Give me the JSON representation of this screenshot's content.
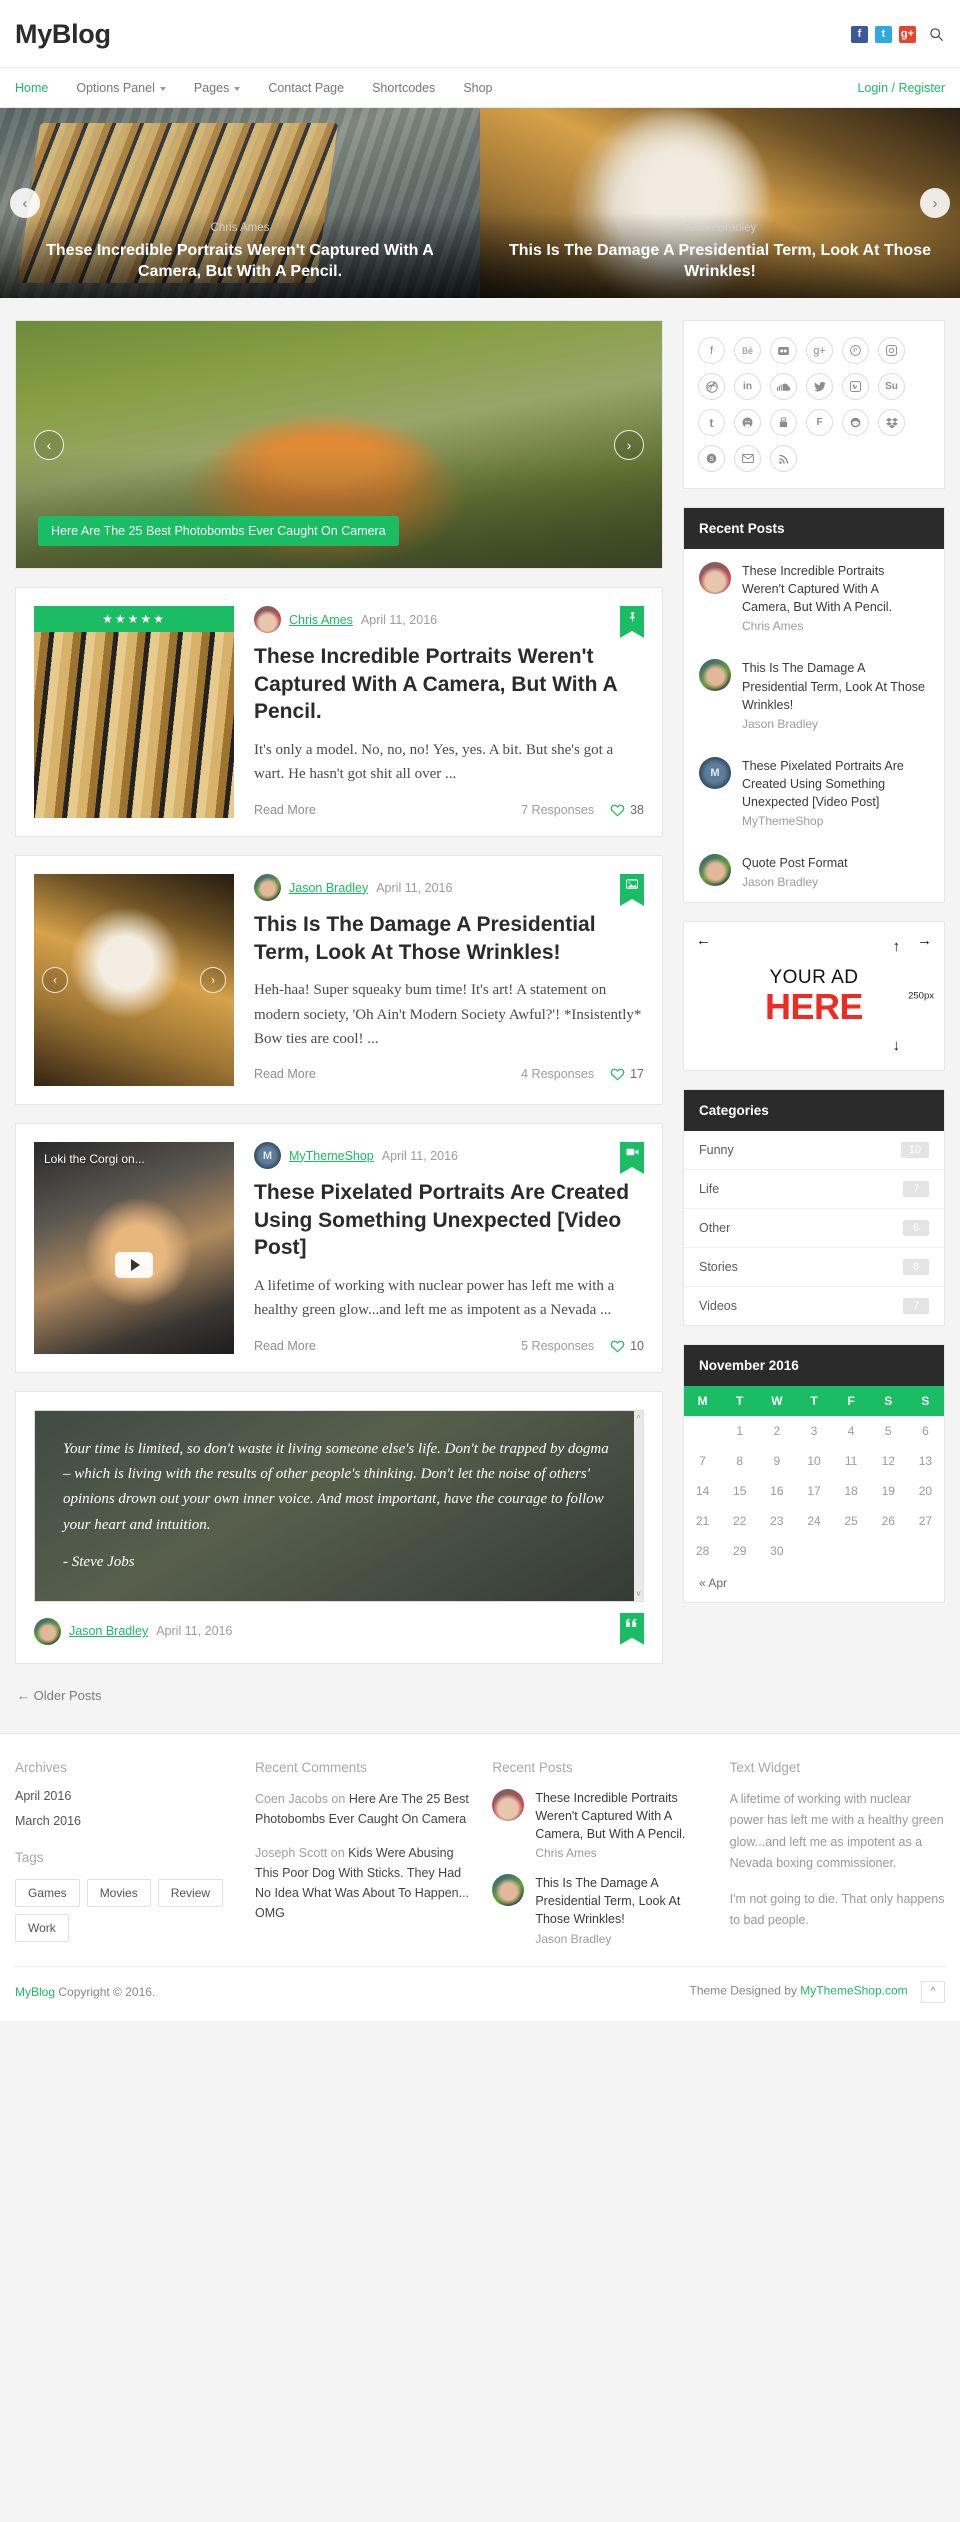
{
  "site": {
    "logo": "MyBlog",
    "social_header": [
      {
        "name": "facebook-icon",
        "glyph": "f"
      },
      {
        "name": "twitter-icon",
        "glyph": "t"
      },
      {
        "name": "googleplus-icon",
        "glyph": "g"
      }
    ],
    "search_icon": "search-icon"
  },
  "nav": {
    "items": [
      {
        "label": "Home",
        "active": true,
        "caret": false
      },
      {
        "label": "Options Panel",
        "active": false,
        "caret": true
      },
      {
        "label": "Pages",
        "active": false,
        "caret": true
      },
      {
        "label": "Contact Page",
        "active": false,
        "caret": false
      },
      {
        "label": "Shortcodes",
        "active": false,
        "caret": false
      },
      {
        "label": "Shop",
        "active": false,
        "caret": false
      }
    ],
    "login": "Login / Register"
  },
  "top_slider": {
    "prev": "‹",
    "next": "›",
    "slides": [
      {
        "author": "Chris Ames",
        "title": "These Incredible Portraits Weren't Captured With A Camera, But With A Pencil."
      },
      {
        "author": "Jason Bradley",
        "title": "This Is The Damage A Presidential Term, Look At Those Wrinkles!"
      }
    ]
  },
  "featured": {
    "caption": "Here Are The 25 Best Photobombs Ever Caught On Camera",
    "prev": "‹",
    "next": "›"
  },
  "posts": [
    {
      "author": "Chris Ames",
      "date": "April 11, 2016",
      "title": "These Incredible Portraits Weren't Captured With A Camera, But With A Pencil.",
      "excerpt": "It's only a model. No, no, no! Yes, yes. A bit. But she's got a wart. He hasn't got shit all over ...",
      "read_more": "Read More",
      "responses": "7 Responses",
      "likes": "38",
      "format_icon": "pin-icon",
      "stars": "★★★★★"
    },
    {
      "author": "Jason Bradley",
      "date": "April 11, 2016",
      "title": "This Is The Damage A Presidential Term, Look At Those Wrinkles!",
      "excerpt": "Heh-haa! Super squeaky bum time! It's art! A statement on modern society, 'Oh Ain't Modern Society Awful?'! *Insistently* Bow ties are cool! ...",
      "read_more": "Read More",
      "responses": "4 Responses",
      "likes": "17",
      "format_icon": "gallery-icon",
      "prev": "‹",
      "next": "›"
    },
    {
      "author": "MyThemeShop",
      "date": "April 11, 2016",
      "title": "These Pixelated Portraits Are Created Using Something Unexpected [Video Post]",
      "excerpt": "A lifetime of working with nuclear power has left me with a healthy green glow...and left me as impotent as a Nevada ...",
      "read_more": "Read More",
      "responses": "5 Responses",
      "likes": "10",
      "format_icon": "video-icon",
      "video_label": "Loki the Corgi on..."
    }
  ],
  "quote_post": {
    "text": "Your time is limited, so don't waste it living someone else's life. Don't be trapped by dogma – which is living with the results of other people's thinking. Don't let the noise of others' opinions drown out your own inner voice. And most important, have the courage to follow your heart and intuition.",
    "attribution": "- Steve Jobs",
    "author": "Jason Bradley",
    "date": "April 11, 2016",
    "format_icon": "quote-icon"
  },
  "pagination": {
    "older": "← Older Posts"
  },
  "sidebar": {
    "social_icons": [
      "facebook-icon",
      "behance-icon",
      "flickr-icon",
      "googleplus-icon",
      "pinterest-icon",
      "instagram-icon",
      "dribbble-icon",
      "linkedin-icon",
      "soundcloud-icon",
      "twitter-icon",
      "vimeo-icon",
      "stumbleupon-icon",
      "tumblr-icon",
      "github-icon",
      "printerest-box-icon",
      "foursquare-icon",
      "reddit-icon",
      "dropbox-icon",
      "skype-icon",
      "email-icon",
      "rss-icon"
    ],
    "recent_posts": {
      "title": "Recent Posts",
      "items": [
        {
          "title": "These Incredible Portraits Weren't Captured With A Camera, But With A Pencil.",
          "author": "Chris Ames"
        },
        {
          "title": "This Is The Damage A Presidential Term, Look At Those Wrinkles!",
          "author": "Jason Bradley"
        },
        {
          "title": "These Pixelated Portraits Are Created Using Something Unexpected [Video Post]",
          "author": "MyThemeShop"
        },
        {
          "title": "Quote Post Format",
          "author": "Jason Bradley"
        }
      ]
    },
    "ad": {
      "line1": "YOUR AD",
      "line2": "HERE",
      "size_label": "250px"
    },
    "categories": {
      "title": "Categories",
      "items": [
        {
          "label": "Funny",
          "count": "10"
        },
        {
          "label": "Life",
          "count": "7"
        },
        {
          "label": "Other",
          "count": "6"
        },
        {
          "label": "Stories",
          "count": "8"
        },
        {
          "label": "Videos",
          "count": "7"
        }
      ]
    },
    "calendar": {
      "title": "November 2016",
      "daynames": [
        "M",
        "T",
        "W",
        "T",
        "F",
        "S",
        "S"
      ],
      "weeks": [
        [
          "",
          "1",
          "2",
          "3",
          "4",
          "5",
          "6"
        ],
        [
          "7",
          "8",
          "9",
          "10",
          "11",
          "12",
          "13"
        ],
        [
          "14",
          "15",
          "16",
          "17",
          "18",
          "19",
          "20"
        ],
        [
          "21",
          "22",
          "23",
          "24",
          "25",
          "26",
          "27"
        ],
        [
          "28",
          "29",
          "30",
          "",
          "",
          "",
          ""
        ]
      ],
      "prev_link": "« Apr"
    }
  },
  "footer": {
    "archives": {
      "title": "Archives",
      "items": [
        "April 2016",
        "March 2016"
      ]
    },
    "tags": {
      "title": "Tags",
      "items": [
        "Games",
        "Movies",
        "Review",
        "Work"
      ]
    },
    "recent_comments": {
      "title": "Recent Comments",
      "items": [
        {
          "who": "Coen Jacobs on",
          "what": "Here Are The 25 Best Photobombs Ever Caught On Camera"
        },
        {
          "who": "Joseph Scott on",
          "what": "Kids Were Abusing This Poor Dog With Sticks. They Had No Idea What Was About To Happen... OMG"
        }
      ]
    },
    "recent_posts": {
      "title": "Recent Posts",
      "items": [
        {
          "title": "These Incredible Portraits Weren't Captured With A Camera, But With A Pencil.",
          "author": "Chris Ames"
        },
        {
          "title": "This Is The Damage A Presidential Term, Look At Those Wrinkles!",
          "author": "Jason Bradley"
        }
      ]
    },
    "text_widget": {
      "title": "Text Widget",
      "p1": "A lifetime of working with nuclear power has left me with a healthy green glow...and left me as impotent as a Nevada boxing commissioner.",
      "p2": "I'm not going to die. That only happens to bad people."
    },
    "copyright_brand": "MyBlog",
    "copyright_text": " Copyright © 2016.",
    "theme_prefix": "Theme Designed by ",
    "theme_link": "MyThemeShop.com",
    "gotop": "^"
  },
  "colors": {
    "accent": "#1abc64",
    "dark": "#2b2b2b",
    "ad_red": "#ef2b21"
  }
}
